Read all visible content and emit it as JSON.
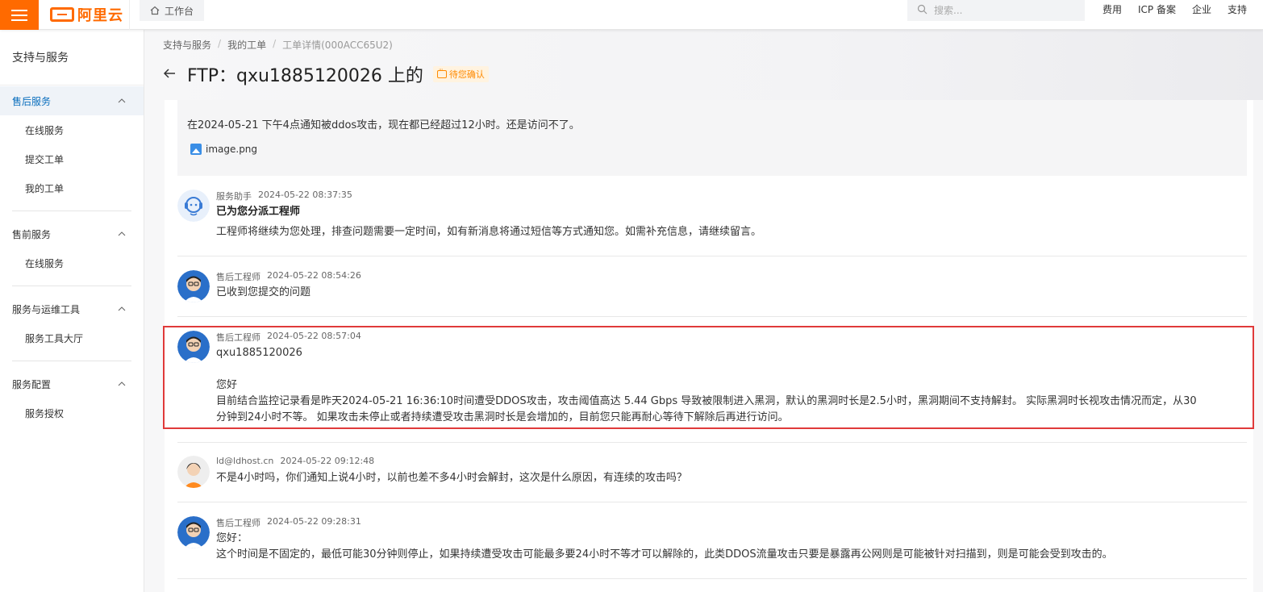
{
  "topbar": {
    "logo_text": "阿里云",
    "workbench_label": "工作台",
    "search_placeholder": "搜索...",
    "links": [
      "费用",
      "ICP 备案",
      "企业",
      "支持"
    ]
  },
  "sidebar": {
    "title": "支持与服务",
    "groups": [
      {
        "label": "售后服务",
        "items": [
          "在线服务",
          "提交工单",
          "我的工单"
        ]
      },
      {
        "label": "售前服务",
        "items": [
          "在线服务"
        ]
      },
      {
        "label": "服务与运维工具",
        "items": [
          "服务工具大厅"
        ]
      },
      {
        "label": "服务配置",
        "items": [
          "服务授权"
        ]
      }
    ]
  },
  "breadcrumb": [
    "支持与服务",
    "我的工单",
    "工单详情(000ACC65U2)"
  ],
  "page": {
    "title": "FTP：qxu1885120026 上的",
    "status": "待您确认"
  },
  "first_message": {
    "text": "在2024-05-21 下午4点通知被ddos攻击，现在都已经超过12小时。还是访问不了。",
    "attachment": "image.png"
  },
  "messages": [
    {
      "author": "服务助手",
      "time": "2024-05-22 08:37:35",
      "headline": "已为您分派工程师",
      "lines": [
        "工程师将继续为您处理，排查问题需要一定时间，如有新消息将通过短信等方式通知您。如需补充信息，请继续留言。"
      ]
    },
    {
      "author": "售后工程师",
      "time": "2024-05-22 08:54:26",
      "lines": [
        "已收到您提交的问题"
      ]
    },
    {
      "author": "售后工程师",
      "time": "2024-05-22 08:57:04",
      "lines": [
        "qxu1885120026",
        "",
        "您好",
        "目前结合监控记录看是昨天2024-05-21 16:36:10时间遭受DDOS攻击，攻击阈值高达  5.44 Gbps 导致被限制进入黑洞，默认的黑洞时长是2.5小时，黑洞期间不支持解封。  实际黑洞时长视攻击情况而定，从30",
        "分钟到24小时不等。  如果攻击未停止或者持续遭受攻击黑洞时长是会增加的，目前您只能再耐心等待下解除后再进行访问。"
      ]
    },
    {
      "author": "ld@ldhost.cn",
      "time": "2024-05-22 09:12:48",
      "lines": [
        "不是4小时吗，你们通知上说4小时，以前也差不多4小时会解封，这次是什么原因，有连续的攻击吗？"
      ]
    },
    {
      "author": "售后工程师",
      "time": "2024-05-22 09:28:31",
      "lines": [
        "您好：",
        "这个时间是不固定的，最低可能30分钟则停止，如果持续遭受攻击可能最多要24小时不等才可以解除的，此类DDOS流量攻击只要是暴露再公网则是可能被针对扫描到，则是可能会受到攻击的。"
      ]
    }
  ],
  "colors": {
    "brand": "#ff6a00",
    "active_blue": "#0a6ebd",
    "highlight": "#e03a3a",
    "status": "#ff8a00"
  }
}
